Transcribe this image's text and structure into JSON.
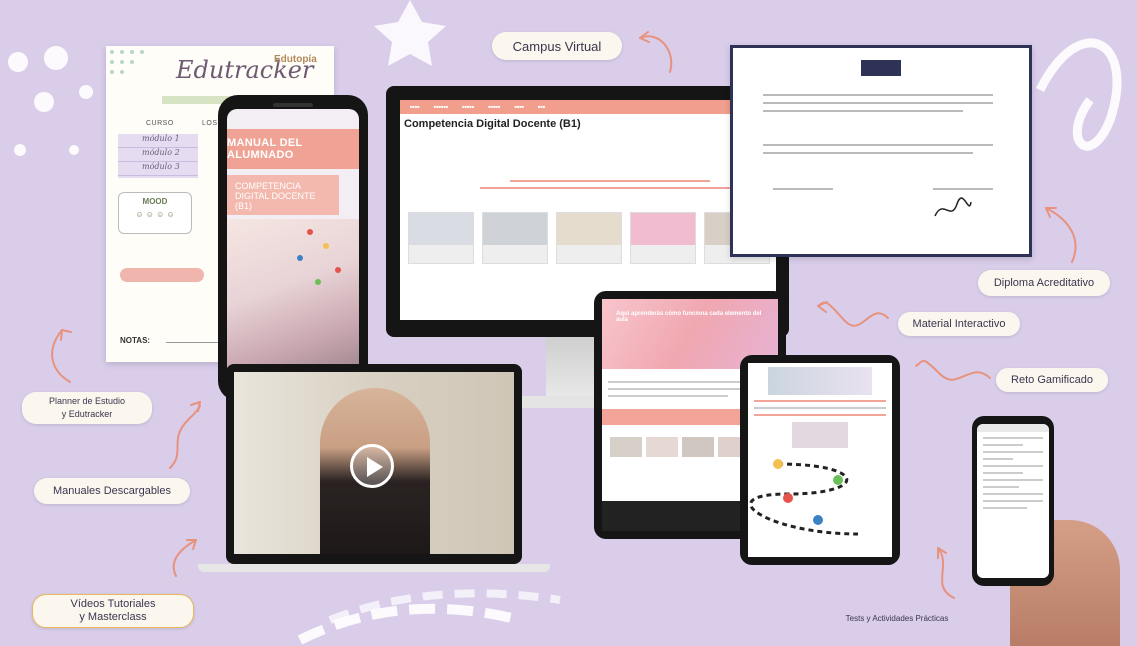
{
  "colors": {
    "background": "#d9cdea",
    "accent": "#f19e8d",
    "label_bg": "#fbf7ee",
    "navy": "#2e3256"
  },
  "labels": {
    "campus_virtual": "Campus Virtual",
    "diploma": "Diploma Acreditativo",
    "material": "Material Interactivo",
    "reto": "Reto Gamificado",
    "planner": "Planner de Estudio\ny Edutracker",
    "manuales": "Manuales Descargables",
    "videos": "Vídeos Tutoriales\ny Masterclass",
    "tests": "Tests y Actividades Prácticas"
  },
  "planner": {
    "logo": "Edutracker",
    "brand": "Edutopía",
    "header_col1": "CURSO",
    "header_col2": "LOS",
    "rows": [
      "módulo 1",
      "módulo 2",
      "módulo 3"
    ],
    "mood_label": "MOOD",
    "total_label": "NOTAS:"
  },
  "phone": {
    "banner": "MANUAL DEL ALUMNADO",
    "subtitle": "COMPETENCIA DIGITAL DOCENTE (B1)"
  },
  "monitor": {
    "title": "Competencia Digital Docente (B1)"
  },
  "tablet_left": {
    "hero_text": "Aquí aprenderás cómo funciona cada elemento del aula"
  },
  "icons": [
    "play-icon",
    "arrow-icon",
    "star-icon"
  ]
}
